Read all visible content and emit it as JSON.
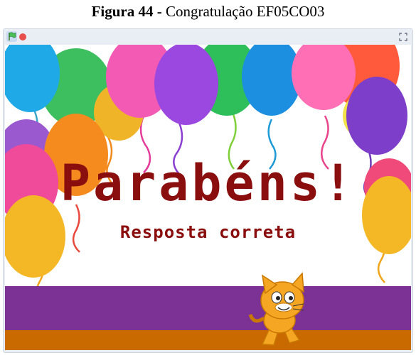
{
  "caption": {
    "label": "Figura 44 -",
    "text": "Congratulação EF05CO03"
  },
  "player": {
    "flag_icon": "green-flag-icon",
    "stop_icon": "stop-icon",
    "fullscreen_icon": "fullscreen-icon"
  },
  "stage": {
    "title": "Parabéns!",
    "subtitle": "Resposta correta",
    "colors": {
      "title": "#8b0e0e",
      "floor_purple": "#7b3294",
      "floor_orange": "#c96a00"
    }
  }
}
